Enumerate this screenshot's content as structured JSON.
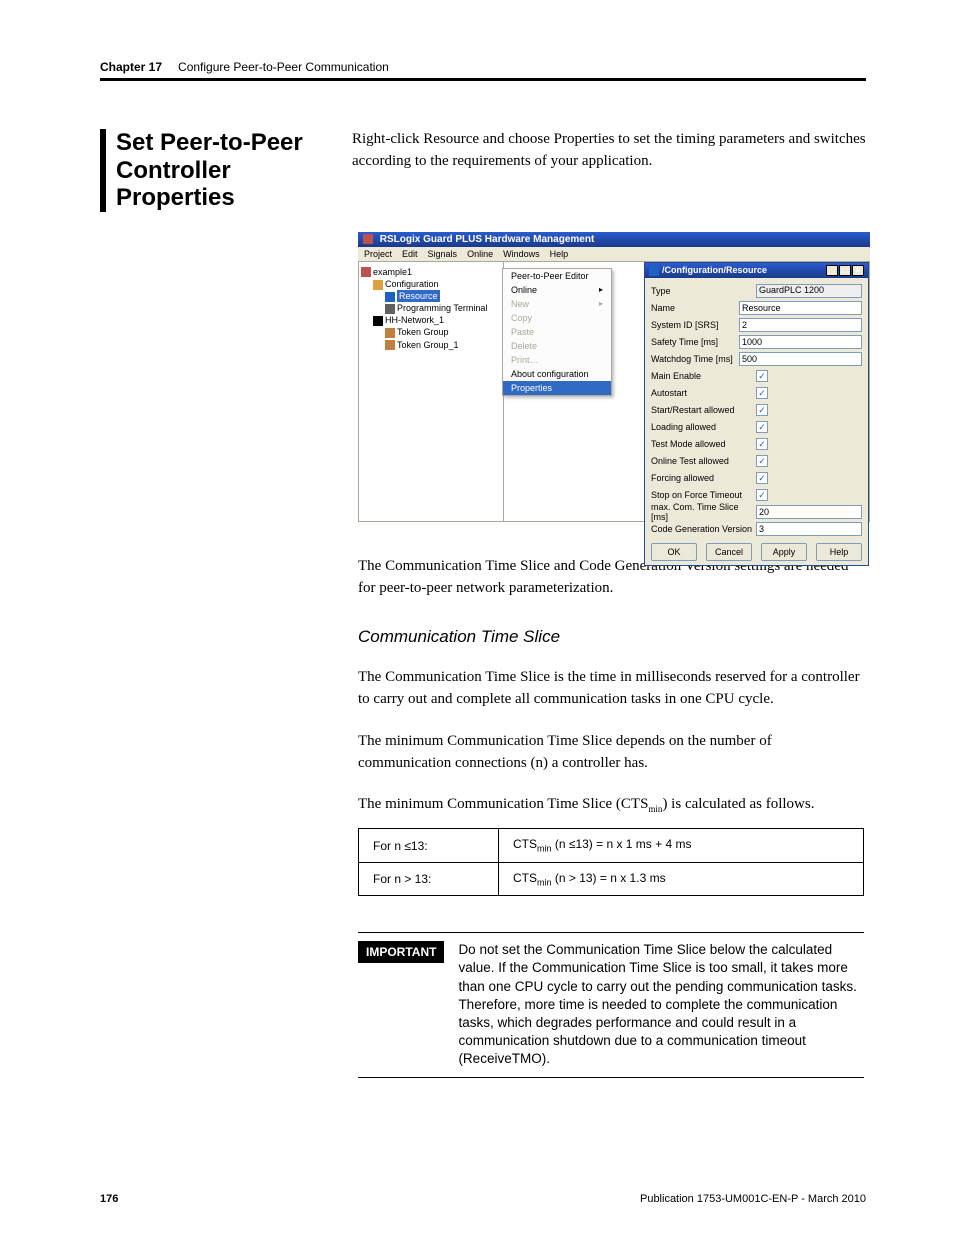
{
  "header": {
    "chapter": "Chapter 17",
    "title": "Configure Peer-to-Peer Communication"
  },
  "section": {
    "heading": "Set Peer-to-Peer Controller Properties",
    "intro": "Right-click Resource and choose Properties to set the timing parameters and switches according to the requirements of your application."
  },
  "app": {
    "title": "RSLogix Guard PLUS Hardware Management",
    "menus": [
      "Project",
      "Edit",
      "Signals",
      "Online",
      "Windows",
      "Help"
    ],
    "tree": {
      "project": "example1",
      "config": "Configuration",
      "resource": "Resource",
      "terminal": "Programming Terminal",
      "network": "HH-Network_1",
      "token1": "Token Group",
      "token2": "Token Group_1"
    },
    "context_menu": [
      {
        "label": "Peer-to-Peer Editor",
        "enabled": true,
        "arrow": false,
        "sel": false
      },
      {
        "label": "Online",
        "enabled": true,
        "arrow": true,
        "sel": false
      },
      {
        "label": "New",
        "enabled": false,
        "arrow": true,
        "sel": false
      },
      {
        "label": "Copy",
        "enabled": false,
        "arrow": false,
        "sel": false
      },
      {
        "label": "Paste",
        "enabled": false,
        "arrow": false,
        "sel": false
      },
      {
        "label": "Delete",
        "enabled": false,
        "arrow": false,
        "sel": false
      },
      {
        "label": "Print…",
        "enabled": false,
        "arrow": false,
        "sel": false
      },
      {
        "label": "About configuration",
        "enabled": true,
        "arrow": false,
        "sel": false
      },
      {
        "label": "Properties",
        "enabled": true,
        "arrow": false,
        "sel": true
      }
    ],
    "dialog": {
      "title": "/Configuration/Resource",
      "fields": {
        "type_label": "Type",
        "type_value": "GuardPLC 1200",
        "name_label": "Name",
        "name_value": "Resource",
        "sysid_label": "System ID [SRS]",
        "sysid_value": "2",
        "safety_label": "Safety Time [ms]",
        "safety_value": "1000",
        "watchdog_label": "Watchdog Time [ms]",
        "watchdog_value": "500",
        "mainen_label": "Main Enable",
        "autostart_label": "Autostart",
        "startrestart_label": "Start/Restart allowed",
        "loading_label": "Loading allowed",
        "testmode_label": "Test Mode allowed",
        "onlinetest_label": "Online Test allowed",
        "forcing_label": "Forcing allowed",
        "stoponforce_label": "Stop on Force Timeout",
        "maxcom_label": "max. Com. Time Slice [ms]",
        "maxcom_value": "20",
        "codegen_label": "Code Generation Version",
        "codegen_value": "3"
      },
      "buttons": {
        "ok": "OK",
        "cancel": "Cancel",
        "apply": "Apply",
        "help": "Help"
      }
    }
  },
  "body": {
    "p1": "The Communication Time Slice and Code Generation Version settings are needed for peer-to-peer network parameterization.",
    "sub1": "Communication Time Slice",
    "p2": "The Communication Time Slice is the time in milliseconds reserved for a controller to carry out and complete all communication tasks in one CPU cycle.",
    "p3": "The minimum Communication Time Slice depends on the number of communication connections (n) a controller has.",
    "p4a": "The minimum Communication Time Slice (CTS",
    "p4b": ") is calculated as follows."
  },
  "ftable": {
    "r1c1": "For n ≤13:",
    "r1c2a": "CTS",
    "r1c2b": " (n ≤13) = n x 1 ms + 4 ms",
    "r2c1": "For n > 13:",
    "r2c2a": "CTS",
    "r2c2b": " (n > 13) = n x 1.3 ms",
    "sub": "min"
  },
  "callout": {
    "badge": "IMPORTANT",
    "text": "Do not set the Communication Time Slice below the calculated value. If the Communication Time Slice is too small, it takes more than one CPU cycle to carry out the pending communication tasks. Therefore, more time is needed to complete the communication tasks, which degrades performance and could result in a communication shutdown due to a communication timeout (ReceiveTMO)."
  },
  "footer": {
    "page": "176",
    "pub": "Publication 1753-UM001C-EN-P - March 2010"
  }
}
